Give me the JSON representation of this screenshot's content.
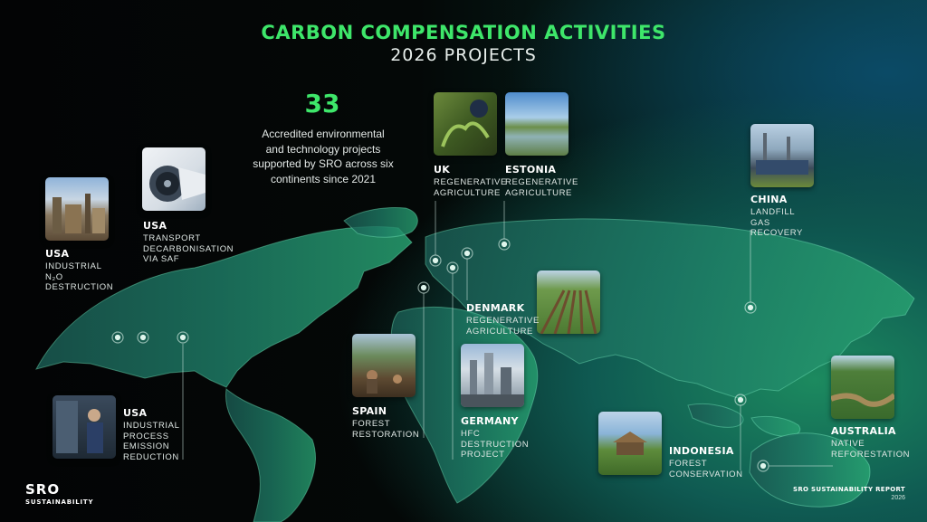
{
  "header": {
    "title": "CARBON COMPENSATION ACTIVITIES",
    "subtitle": "2026 PROJECTS"
  },
  "stat": {
    "number": "33",
    "text": "Accredited environmental and technology projects supported by SRO across six continents since 2021"
  },
  "projects": [
    {
      "country": "USA",
      "description": "INDUSTRIAL N₂O DESTRUCTION",
      "photo_icon": "factory-photo-icon"
    },
    {
      "country": "USA",
      "description": "TRANSPORT DECARBONISATION VIA SAF",
      "photo_icon": "jet-engine-photo-icon"
    },
    {
      "country": "USA",
      "description": "INDUSTRIAL PROCESS EMISSION REDUCTION",
      "photo_icon": "technician-photo-icon"
    },
    {
      "country": "SPAIN",
      "description": "FOREST RESTORATION",
      "photo_icon": "forest-planting-photo-icon"
    },
    {
      "country": "UK",
      "description": "REGENERATIVE AGRICULTURE",
      "photo_icon": "plants-photo-icon"
    },
    {
      "country": "ESTONIA",
      "description": "REGENERATIVE AGRICULTURE",
      "photo_icon": "wetland-photo-icon"
    },
    {
      "country": "DENMARK",
      "description": "REGENERATIVE AGRICULTURE",
      "photo_icon": "crop-rows-photo-icon"
    },
    {
      "country": "GERMANY",
      "description": "HFC DESTRUCTION PROJECT",
      "photo_icon": "plant-facility-photo-icon"
    },
    {
      "country": "CHINA",
      "description": "LANDFILL GAS RECOVERY",
      "photo_icon": "gas-plant-photo-icon"
    },
    {
      "country": "INDONESIA",
      "description": "FOREST CONSERVATION",
      "photo_icon": "hut-photo-icon"
    },
    {
      "country": "AUSTRALIA",
      "description": "NATIVE REFORESTATION",
      "photo_icon": "river-forest-photo-icon"
    }
  ],
  "footer": {
    "logo_main": "SRO",
    "logo_sub": "SUSTAINABILITY",
    "report_title": "SRO SUSTAINABILITY REPORT",
    "report_year": "2026"
  },
  "colors": {
    "accent": "#3ee66a",
    "map_fill": "#1e8a6d",
    "background_dark": "#030405"
  }
}
